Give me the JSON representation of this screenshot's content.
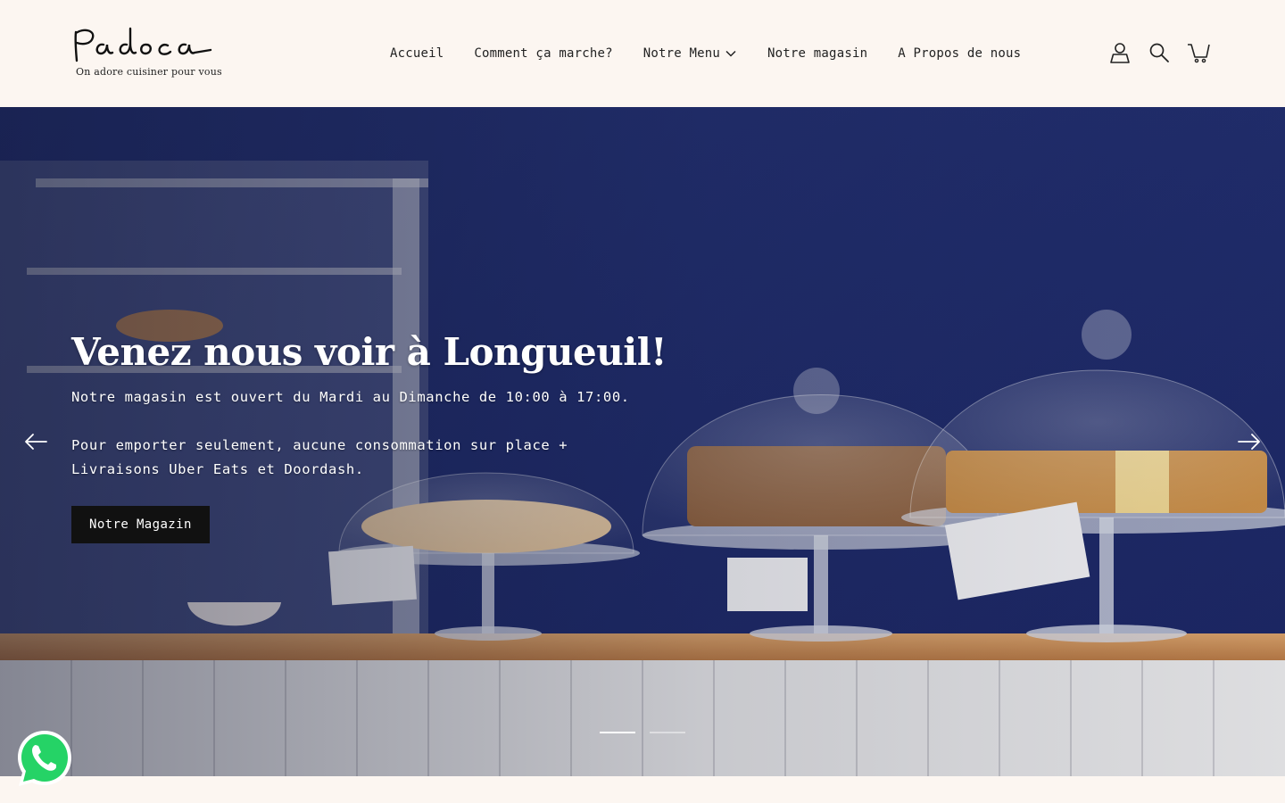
{
  "brand": {
    "logo_text": "Padoca",
    "tagline": "On adore cuisiner pour vous"
  },
  "nav": {
    "items": [
      {
        "label": "Accueil"
      },
      {
        "label": "Comment ça marche?"
      },
      {
        "label": "Notre Menu",
        "has_dropdown": true
      },
      {
        "label": "Notre magasin"
      },
      {
        "label": "A Propos de nous"
      }
    ]
  },
  "header_icons": [
    "account-icon",
    "search-icon",
    "cart-icon"
  ],
  "hero": {
    "title": "Venez nous voir à Longueuil!",
    "line1": "Notre magasin est ouvert du Mardi au Dimanche de 10:00 à 17:00.",
    "line2": "Pour emporter seulement, aucune consommation sur place + Livraisons Uber Eats et Doordash.",
    "button_label": "Notre Magazin",
    "slides_total": 2,
    "active_slide": 1
  },
  "colors": {
    "page_bg": "#fcf6f1",
    "hero_wall": "#1f2d6b",
    "button_bg": "#111111",
    "whatsapp": "#25d366"
  }
}
